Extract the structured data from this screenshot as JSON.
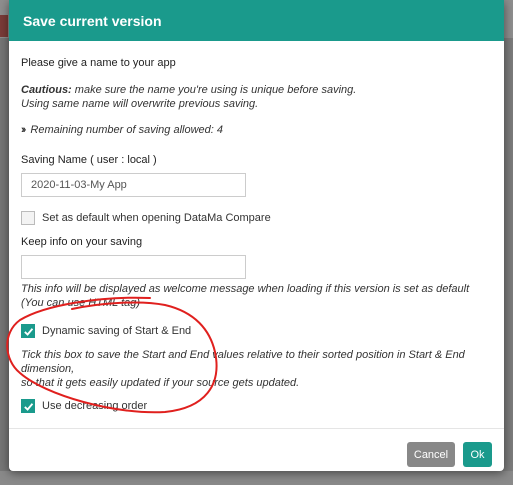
{
  "dialog": {
    "title": "Save current version",
    "intro": "Please give a name to your app",
    "caution_label": "Cautious:",
    "caution_text": " make sure the name you're using is unique before saving.",
    "caution_text2": "Using same name will overwrite previous saving.",
    "remaining_icon": "double-chevron-right-icon",
    "remaining_text": "Remaining number of saving allowed: 4",
    "saving_name_label": "Saving Name ( user : local )",
    "saving_name_value": "2020-11-03-My App",
    "set_default_label": "Set as default when opening DataMa Compare",
    "set_default_checked": false,
    "keep_info_label": "Keep info on your saving",
    "keep_info_value": "",
    "keep_info_hint1": "This info will be displayed as welcome message when loading if this version is set as default",
    "keep_info_hint2": "(You can use HTML tag)",
    "dynamic_label": "Dynamic saving of Start & End",
    "dynamic_checked": true,
    "dynamic_hint1": "Tick this box to save the Start and End values relative to their sorted position in Start & End dimension,",
    "dynamic_hint2": "so that it gets easily updated if your source gets updated.",
    "decreasing_label": "Use decreasing order",
    "decreasing_checked": true,
    "cancel_label": "Cancel",
    "ok_label": "Ok"
  },
  "colors": {
    "accent": "#1a9a8c",
    "cancel": "#888888",
    "annotation": "#e0201e"
  }
}
